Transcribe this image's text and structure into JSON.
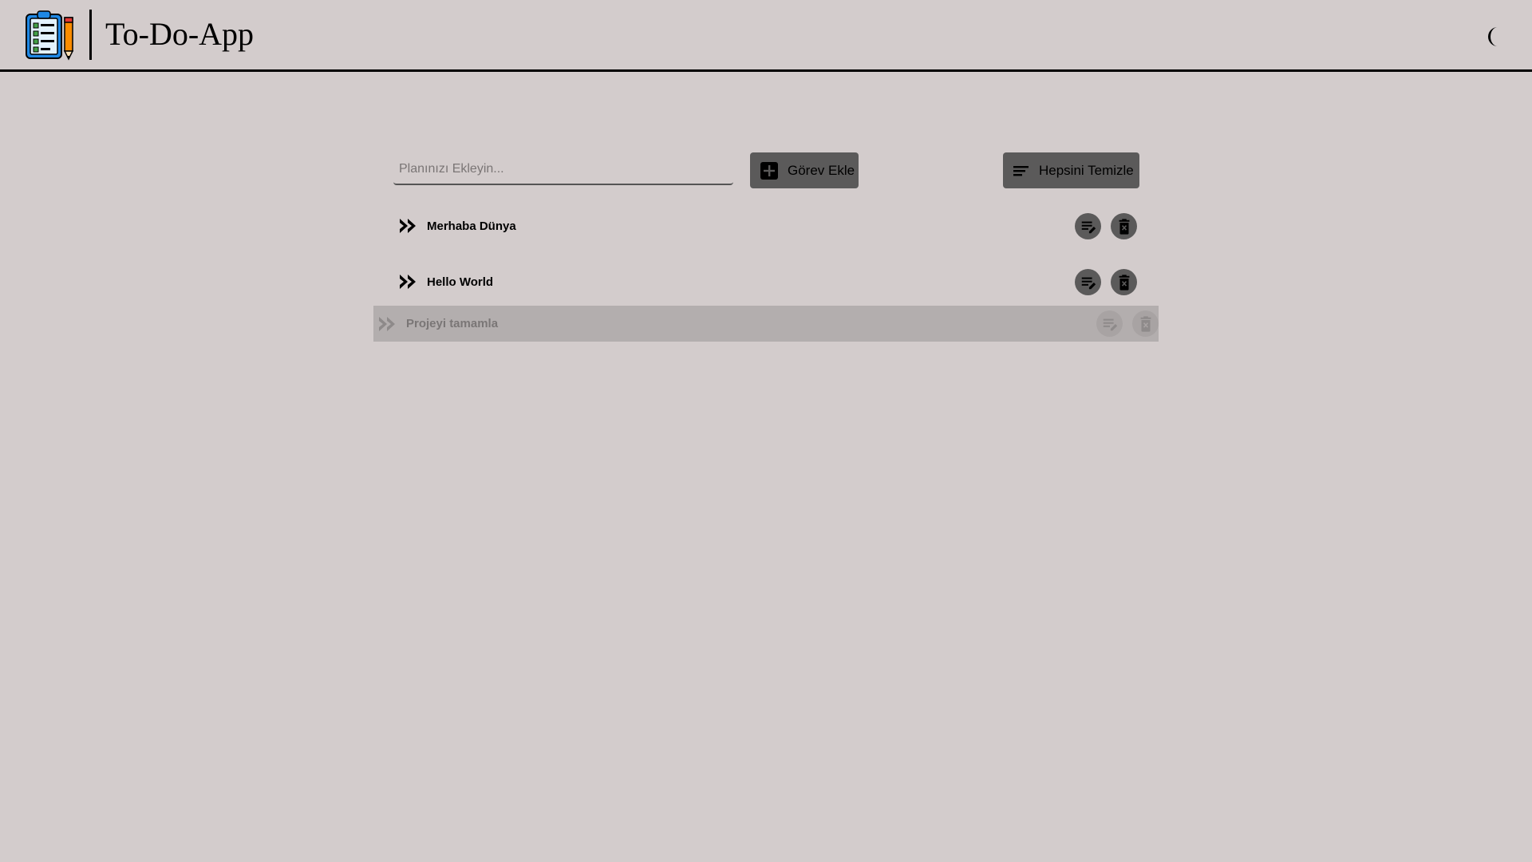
{
  "header": {
    "title": "To-Do-App",
    "logo_icon": "clipboard-checklist-pencil-icon",
    "theme_icon": "moon-icon"
  },
  "input": {
    "placeholder": "Planınızı Ekleyin...",
    "value": ""
  },
  "buttons": {
    "add_label": "Görev Ekle",
    "add_icon": "plus-box-icon",
    "clear_label": "Hepsini Temizle",
    "clear_icon": "sort-lines-icon"
  },
  "tasks": [
    {
      "text": "Merhaba Dünya",
      "state": "normal"
    },
    {
      "text": "Hello World",
      "state": "normal"
    },
    {
      "text": "Projeyi tamamla",
      "state": "dragging"
    }
  ],
  "colors": {
    "background": "#d3cccc",
    "button": "#5b5a5a",
    "drag_row": "#b3aeae"
  }
}
